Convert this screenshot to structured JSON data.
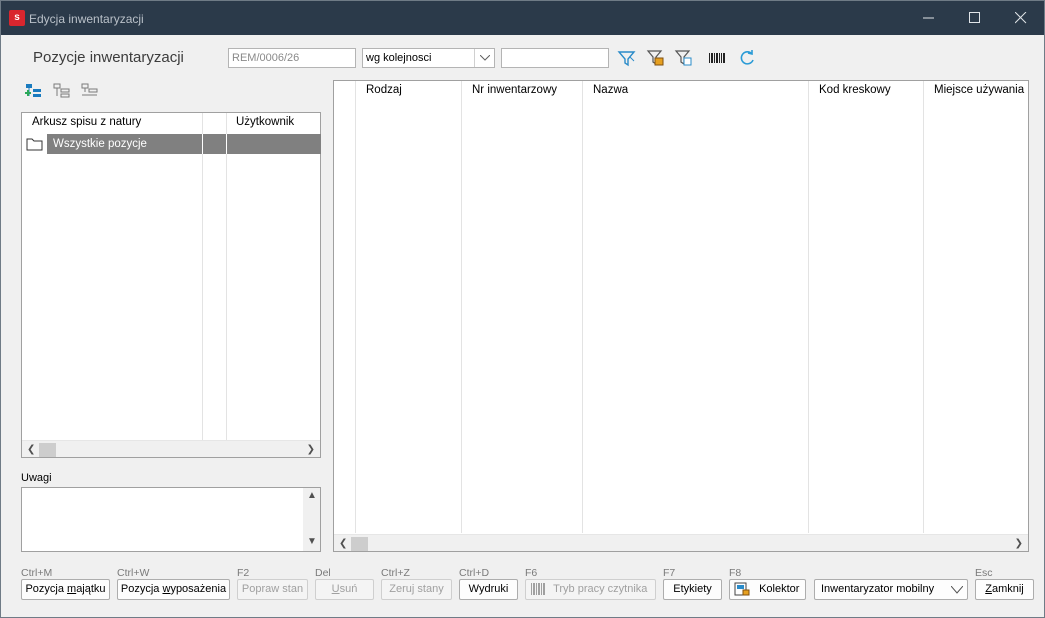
{
  "window": {
    "title": "Edycja inwentaryzacji",
    "app_icon_letter": "s"
  },
  "header": {
    "section_title": "Pozycje inwentaryzacji",
    "document_number": "REM/0006/26",
    "order_select": "wg kolejnosci",
    "search_value": ""
  },
  "tree": {
    "columns": [
      "Arkusz spisu z natury",
      "",
      "Użytkownik"
    ],
    "rows": [
      {
        "label": "Wszystkie pozycje"
      }
    ]
  },
  "notes": {
    "label": "Uwagi",
    "value": ""
  },
  "grid": {
    "columns": [
      "",
      "Rodzaj",
      "Nr inwentarzowy",
      "Nazwa",
      "Kod kreskowy",
      "Miejsce używania"
    ]
  },
  "buttons": [
    {
      "shortcut": "Ctrl+M",
      "pre": "Pozycja ",
      "ul": "m",
      "post": "ajątku",
      "disabled": false
    },
    {
      "shortcut": "Ctrl+W",
      "pre": "Pozycja ",
      "ul": "w",
      "post": "yposażenia",
      "disabled": false
    },
    {
      "shortcut": "F2",
      "pre": "Popraw stan",
      "ul": "",
      "post": "",
      "disabled": true
    },
    {
      "shortcut": "Del",
      "pre": "",
      "ul": "U",
      "post": "suń",
      "disabled": true
    },
    {
      "shortcut": "Ctrl+Z",
      "pre": "Zeruj stany",
      "ul": "",
      "post": "",
      "disabled": true
    },
    {
      "shortcut": "Ctrl+D",
      "pre": "Wydruki",
      "ul": "",
      "post": "",
      "disabled": false
    },
    {
      "shortcut": "F6",
      "pre": "Tryb pracy czytnika",
      "ul": "",
      "post": "",
      "disabled": true
    },
    {
      "shortcut": "F7",
      "pre": "Etykiety",
      "ul": "",
      "post": "",
      "disabled": false
    },
    {
      "shortcut": "F8",
      "pre": "Kolektor",
      "ul": "",
      "post": "",
      "disabled": false
    },
    {
      "shortcut": "",
      "pre": "Inwentaryzator mobilny",
      "ul": "",
      "post": "",
      "disabled": false
    },
    {
      "shortcut": "Esc",
      "pre": "",
      "ul": "Z",
      "post": "amknij",
      "disabled": false
    }
  ],
  "icons": [
    "filter-icon",
    "filter-lock-icon",
    "filter-clear-icon",
    "barcode-icon",
    "refresh-icon",
    "tree-add-icon",
    "tree-expand-icon",
    "tree-collapse-icon",
    "folder-icon"
  ]
}
